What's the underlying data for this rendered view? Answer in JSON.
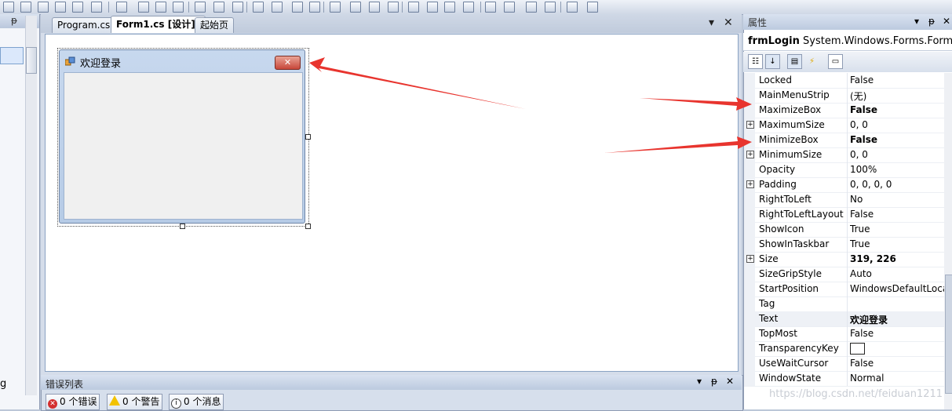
{
  "document_tabs": [
    {
      "label": "Program.cs"
    },
    {
      "label": "Form1.cs [设计]*"
    },
    {
      "label": "起始页"
    }
  ],
  "left_panel": {
    "partial_text": "g"
  },
  "form_preview": {
    "title": "欢迎登录",
    "close_glyph": "✕"
  },
  "error_list": {
    "title": "错误列表",
    "errors_label": "0 个错误",
    "warnings_label": "0 个警告",
    "messages_label": "0 个消息"
  },
  "properties": {
    "title": "属性",
    "object_name": "frmLogin",
    "object_type": "System.Windows.Forms.Form",
    "rows": [
      {
        "name": "Locked",
        "value": "False",
        "bold": false,
        "expandable": false
      },
      {
        "name": "MainMenuStrip",
        "value": "(无)",
        "bold": false,
        "expandable": false
      },
      {
        "name": "MaximizeBox",
        "value": "False",
        "bold": true,
        "expandable": false
      },
      {
        "name": "MaximumSize",
        "value": "0, 0",
        "bold": false,
        "expandable": true
      },
      {
        "name": "MinimizeBox",
        "value": "False",
        "bold": true,
        "expandable": false
      },
      {
        "name": "MinimumSize",
        "value": "0, 0",
        "bold": false,
        "expandable": true
      },
      {
        "name": "Opacity",
        "value": "100%",
        "bold": false,
        "expandable": false
      },
      {
        "name": "Padding",
        "value": "0, 0, 0, 0",
        "bold": false,
        "expandable": true
      },
      {
        "name": "RightToLeft",
        "value": "No",
        "bold": false,
        "expandable": false
      },
      {
        "name": "RightToLeftLayout",
        "value": "False",
        "bold": false,
        "expandable": false
      },
      {
        "name": "ShowIcon",
        "value": "True",
        "bold": false,
        "expandable": false
      },
      {
        "name": "ShowInTaskbar",
        "value": "True",
        "bold": false,
        "expandable": false
      },
      {
        "name": "Size",
        "value": "319, 226",
        "bold": true,
        "expandable": true
      },
      {
        "name": "SizeGripStyle",
        "value": "Auto",
        "bold": false,
        "expandable": false
      },
      {
        "name": "StartPosition",
        "value": "WindowsDefaultLoca",
        "bold": false,
        "expandable": false
      },
      {
        "name": "Tag",
        "value": "",
        "bold": false,
        "expandable": false
      },
      {
        "name": "Text",
        "value": "欢迎登录",
        "bold": true,
        "expandable": false
      },
      {
        "name": "TopMost",
        "value": "False",
        "bold": false,
        "expandable": false
      },
      {
        "name": "TransparencyKey",
        "value": "",
        "bold": false,
        "expandable": false
      },
      {
        "name": "UseWaitCursor",
        "value": "False",
        "bold": false,
        "expandable": false
      },
      {
        "name": "WindowState",
        "value": "Normal",
        "bold": false,
        "expandable": false
      }
    ]
  },
  "watermark": "https://blog.csdn.net/feiduan1211",
  "colors": {
    "annotation_arrow": "#e8342e",
    "close_button": "#c8473a"
  }
}
